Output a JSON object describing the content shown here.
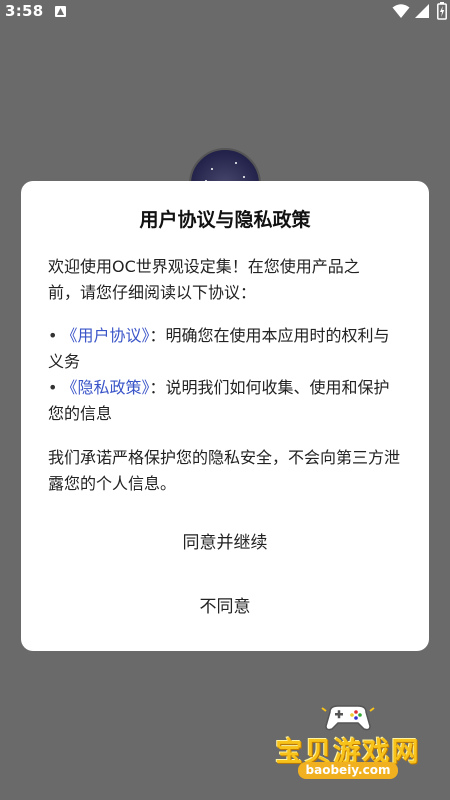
{
  "status_bar": {
    "time": "3:58",
    "icons": [
      "notification-icon",
      "wifi-icon",
      "signal-icon",
      "battery-icon"
    ]
  },
  "dialog": {
    "title": "用户协议与隐私政策",
    "intro": "欢迎使用OC世界观设定集！在您使用产品之前，请您仔细阅读以下协议：",
    "bullets": [
      {
        "dot": "•",
        "link": "《用户协议》",
        "text": "：明确您在使用本应用时的权利与义务"
      },
      {
        "dot": "•",
        "link": "《隐私政策》",
        "text": "：说明我们如何收集、使用和保护您的信息"
      }
    ],
    "promise": "我们承诺严格保护您的隐私安全，不会向第三方泄露您的个人信息。",
    "agree_label": "同意并继续",
    "disagree_label": "不同意"
  },
  "watermark": {
    "title": "宝贝游戏网",
    "url": "baobeiy.com"
  },
  "colors": {
    "overlay": "#6a6a6a",
    "dialog_bg": "#ffffff",
    "link": "#3a55c8",
    "watermark_gold": "#f7c21a"
  }
}
